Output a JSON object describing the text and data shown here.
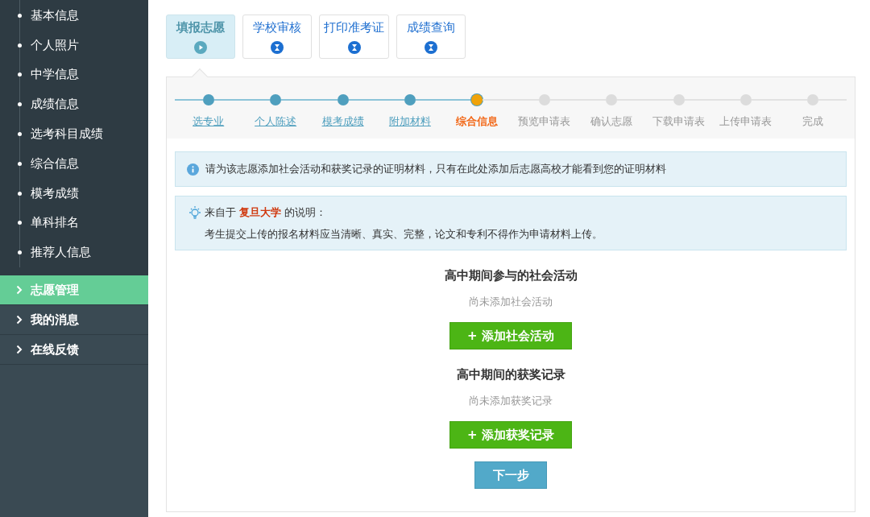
{
  "sidebar": {
    "sub_items": [
      {
        "label": "基本信息"
      },
      {
        "label": "个人照片"
      },
      {
        "label": "中学信息"
      },
      {
        "label": "成绩信息"
      },
      {
        "label": "选考科目成绩"
      },
      {
        "label": "综合信息"
      },
      {
        "label": "模考成绩"
      },
      {
        "label": "单科排名"
      },
      {
        "label": "推荐人信息"
      }
    ],
    "menu": [
      {
        "label": "志愿管理",
        "selected": true
      },
      {
        "label": "我的消息",
        "selected": false
      },
      {
        "label": "在线反馈",
        "selected": false
      }
    ]
  },
  "stage_tabs": [
    {
      "label": "填报志愿",
      "selected": true
    },
    {
      "label": "学校审核",
      "selected": false
    },
    {
      "label": "打印准考证",
      "selected": false
    },
    {
      "label": "成绩查询",
      "selected": false
    }
  ],
  "steps": [
    {
      "label": "选专业",
      "done": true,
      "selected": false
    },
    {
      "label": "个人陈述",
      "done": true,
      "selected": false
    },
    {
      "label": "模考成绩",
      "done": true,
      "selected": false
    },
    {
      "label": "附加材料",
      "done": true,
      "selected": false
    },
    {
      "label": "综合信息",
      "done": false,
      "selected": true
    },
    {
      "label": "预览申请表",
      "done": false,
      "selected": false
    },
    {
      "label": "确认志愿",
      "done": false,
      "selected": false
    },
    {
      "label": "下载申请表",
      "done": false,
      "selected": false
    },
    {
      "label": "上传申请表",
      "done": false,
      "selected": false
    },
    {
      "label": "完成",
      "done": false,
      "selected": false
    }
  ],
  "info_notice": "请为该志愿添加社会活动和获奖记录的证明材料，只有在此处添加后志愿高校才能看到您的证明材料",
  "school_note": {
    "title": "来自于 **复旦大学** 的说明：",
    "text": "考生提交上传的报名材料应当清晰、真实、完整，论文和专利不得作为申请材料上传。"
  },
  "sections": [
    {
      "title": "高中期间参与的社会活动",
      "empty_text": "尚未添加社会活动",
      "button": "+ 添加社会活动"
    },
    {
      "title": "高中期间的获奖记录",
      "empty_text": "尚未添加获奖记录",
      "button": "+ 添加获奖记录"
    }
  ],
  "next_button": "下一步"
}
